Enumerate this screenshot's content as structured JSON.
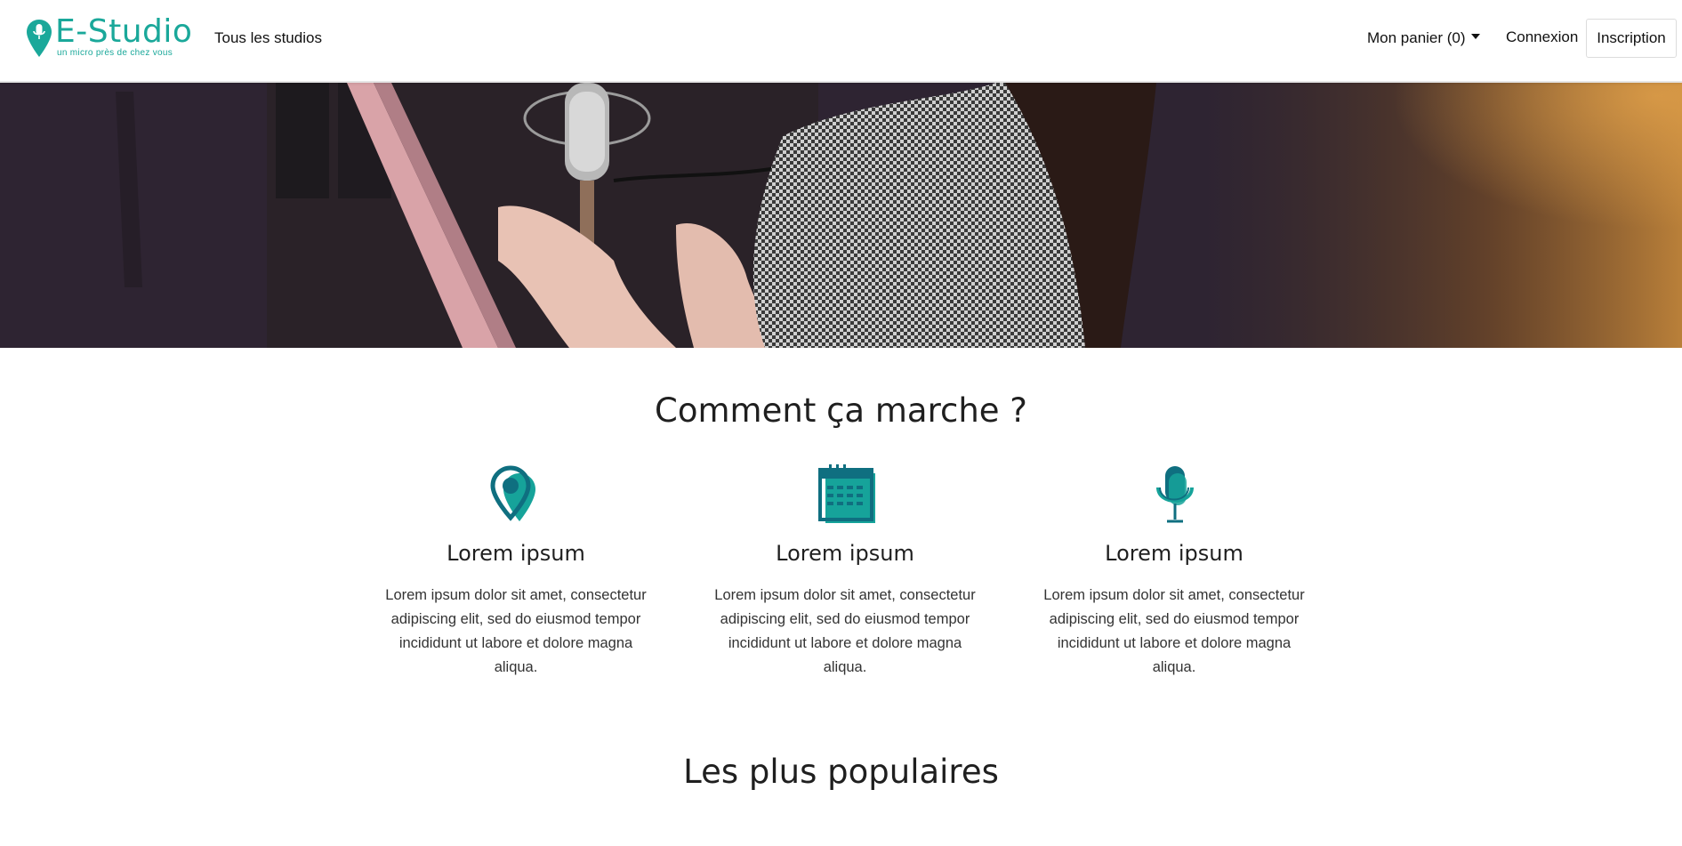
{
  "colors": {
    "brand": "#1aa89a",
    "icon_dark": "#0f6f80",
    "icon_teal": "#16a39a",
    "text": "#1f1f1f"
  },
  "navbar": {
    "brand_name": "E-Studio",
    "brand_tagline": "un micro près de chez vous",
    "brand_icon": "map-pin-microphone-icon",
    "links": {
      "studios": "Tous les studios",
      "cart": "Mon panier (0)",
      "login": "Connexion",
      "signup": "Inscription"
    }
  },
  "hero": {
    "image_description_icon": "studio-singer-microphone-photo"
  },
  "how_it_works": {
    "title": "Comment ça marche ?",
    "features": [
      {
        "icon": "location-pin-icon",
        "title": "Lorem ipsum",
        "text": "Lorem ipsum dolor sit amet, consectetur adipiscing elit, sed do eiusmod tempor incididunt ut labore et dolore magna aliqua."
      },
      {
        "icon": "calendar-icon",
        "title": "Lorem ipsum",
        "text": "Lorem ipsum dolor sit amet, consectetur adipiscing elit, sed do eiusmod tempor incididunt ut labore et dolore magna aliqua."
      },
      {
        "icon": "microphone-icon",
        "title": "Lorem ipsum",
        "text": "Lorem ipsum dolor sit amet, consectetur adipiscing elit, sed do eiusmod tempor incididunt ut labore et dolore magna aliqua."
      }
    ]
  },
  "popular": {
    "title": "Les plus populaires"
  }
}
